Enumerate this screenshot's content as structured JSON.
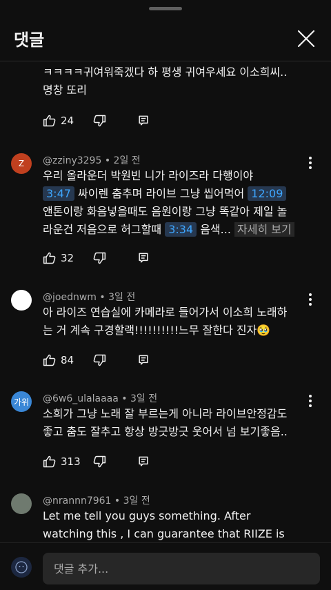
{
  "header": {
    "title": "댓글"
  },
  "comments": [
    {
      "text_line1": "ㅋㅋㅋㅋ귀여워죽겠다 하 평생 귀여우세요 이소희씨..",
      "text_line2": "명창 또리",
      "likes": "24"
    },
    {
      "avatar_letter": "Z",
      "avatar_color": "#c0401f",
      "user": "@zziny3295",
      "time": "2일 전",
      "l1": "우리 올라운더 박원빈 니가 라이즈라 다행이야",
      "ts1": "3:47",
      "l2": "싸이렌 춤추며 라이브 그냥 씹어먹어",
      "ts2": "12:09",
      "l3": "앤톤이랑 화음넣을때도 음원이랑 그냥 똑같아 제일 놀",
      "l4a": "라운건 저음으로 허그할때",
      "ts3": "3:34",
      "l4b": "음색...",
      "readmore": "자세히 보기",
      "likes": "32"
    },
    {
      "avatar_color": "#ffffff",
      "user": "@joednwm",
      "time": "3일 전",
      "l1": "아 라이즈 연습실에 카메라로 들어가서 이소희 노래하",
      "l2": "는 거 계속 구경할랙!!!!!!!!!!느무 잘한다 진자🥹",
      "likes": "84"
    },
    {
      "avatar_letter": "가위",
      "avatar_color": "#3a87d6",
      "user": "@6w6_ulalaaaa",
      "time": "3일 전",
      "l1": "소희가 그냥 노래 잘 부르는게 아니라 라이브안정감도",
      "l2": "좋고 춤도 잘추고 항상 방긋방긋 웃어서 넘 보기좋음..",
      "likes": "313"
    },
    {
      "avatar_color": "#6f7a6f",
      "user": "@nrannn7961",
      "time": "3일 전",
      "l1": "Let me tell you guys something. After",
      "l2": "watching this , I can guarantee that RIIZE is"
    }
  ],
  "composer": {
    "placeholder": "댓글 추가..."
  }
}
